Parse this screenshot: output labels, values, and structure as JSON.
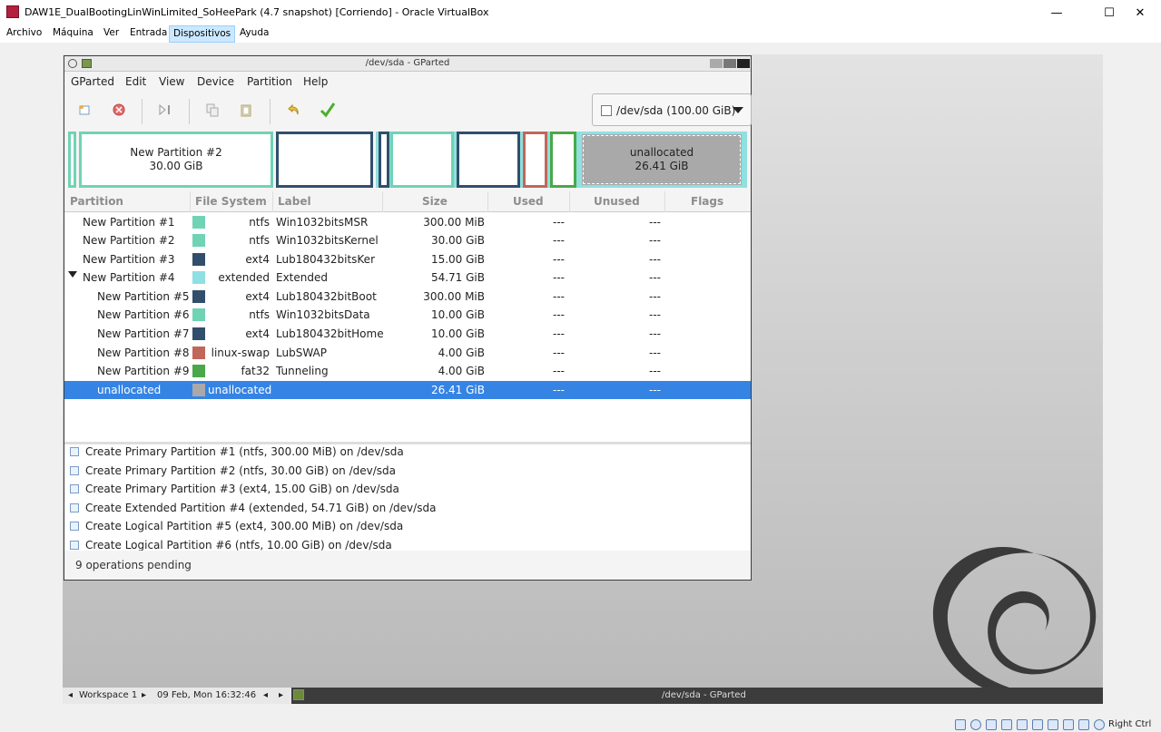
{
  "window": {
    "title": "DAW1E_DualBootingLinWinLimited_SoHeePark (4.7 snapshot) [Corriendo] - Oracle VirtualBox"
  },
  "host_menu": [
    "Archivo",
    "Máquina",
    "Ver",
    "Entrada",
    "Dispositivos",
    "Ayuda"
  ],
  "gparted": {
    "title": "/dev/sda - GParted",
    "menu": [
      "GParted",
      "Edit",
      "View",
      "Device",
      "Partition",
      "Help"
    ],
    "device": "/dev/sda (100.00 GiB)",
    "map": {
      "p2_name": "New Partition #2",
      "p2_size": "30.00 GiB",
      "unalloc_name": "unallocated",
      "unalloc_size": "26.41 GiB"
    },
    "columns": [
      "Partition",
      "File System",
      "Label",
      "Size",
      "Used",
      "Unused",
      "Flags"
    ],
    "rows": [
      {
        "partition": "New Partition #1",
        "fs": "ntfs",
        "label": "Win1032bitsMSR",
        "size": "300.00 MiB",
        "used": "---",
        "unused": "---",
        "color": "#6fd3b4"
      },
      {
        "partition": "New Partition #2",
        "fs": "ntfs",
        "label": "Win1032bitsKernel",
        "size": "30.00 GiB",
        "used": "---",
        "unused": "---",
        "color": "#6fd3b4"
      },
      {
        "partition": "New Partition #3",
        "fs": "ext4",
        "label": "Lub180432bitsKer",
        "size": "15.00 GiB",
        "used": "---",
        "unused": "---",
        "color": "#314e6c"
      },
      {
        "partition": "New Partition #4",
        "fs": "extended",
        "label": "Extended",
        "size": "54.71 GiB",
        "used": "---",
        "unused": "---",
        "color": "#8fe0e4"
      },
      {
        "partition": "New Partition #5",
        "fs": "ext4",
        "label": "Lub180432bitBoot",
        "size": "300.00 MiB",
        "used": "---",
        "unused": "---",
        "color": "#314e6c"
      },
      {
        "partition": "New Partition #6",
        "fs": "ntfs",
        "label": "Win1032bitsData",
        "size": "10.00 GiB",
        "used": "---",
        "unused": "---",
        "color": "#6fd3b4"
      },
      {
        "partition": "New Partition #7",
        "fs": "ext4",
        "label": "Lub180432bitHome",
        "size": "10.00 GiB",
        "used": "---",
        "unused": "---",
        "color": "#314e6c"
      },
      {
        "partition": "New Partition #8",
        "fs": "linux-swap",
        "label": "LubSWAP",
        "size": "4.00 GiB",
        "used": "---",
        "unused": "---",
        "color": "#c1665a"
      },
      {
        "partition": "New Partition #9",
        "fs": "fat32",
        "label": "Tunneling",
        "size": "4.00 GiB",
        "used": "---",
        "unused": "---",
        "color": "#4aa84a"
      },
      {
        "partition": "unallocated",
        "fs": "unallocated",
        "label": "",
        "size": "26.41 GiB",
        "used": "---",
        "unused": "---",
        "color": "#a9a9a9"
      }
    ],
    "operations": [
      "Create Primary Partition #1 (ntfs, 300.00 MiB) on /dev/sda",
      "Create Primary Partition #2 (ntfs, 30.00 GiB) on /dev/sda",
      "Create Primary Partition #3 (ext4, 15.00 GiB) on /dev/sda",
      "Create Extended Partition #4 (extended, 54.71 GiB) on /dev/sda",
      "Create Logical Partition #5 (ext4, 300.00 MiB) on /dev/sda",
      "Create Logical Partition #6 (ntfs, 10.00 GiB) on /dev/sda"
    ],
    "status": "9 operations pending"
  },
  "taskbar": {
    "workspace": "Workspace 1",
    "clock": "09 Feb, Mon 16:32:46",
    "task": "/dev/sda - GParted"
  },
  "host_tray": {
    "hostkey": "Right Ctrl"
  }
}
